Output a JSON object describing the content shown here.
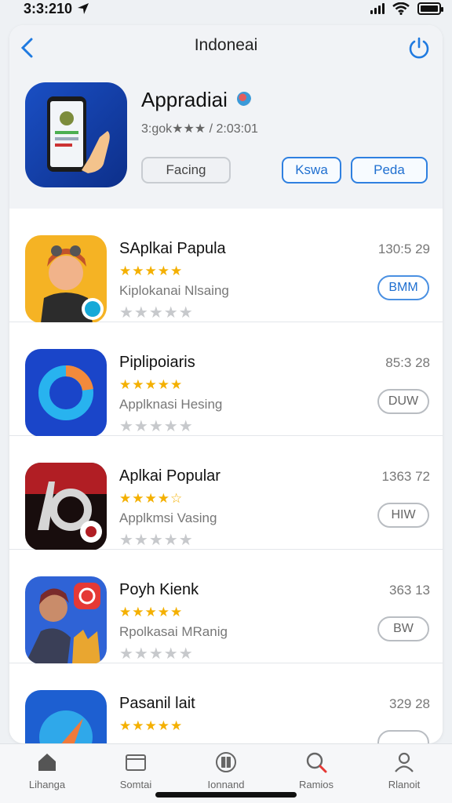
{
  "status_bar": {
    "time": "3:3:210"
  },
  "nav": {
    "title": "Indoneai"
  },
  "featured": {
    "title": "Appradiai",
    "meta": "3:gok★★★ / 2:03:01",
    "buttons": {
      "secondary": "Facing",
      "primary_1": "Kswa",
      "primary_2": "Peda"
    }
  },
  "list": [
    {
      "title": "SAplkai Papula",
      "stars": "★★★★★",
      "subtitle": "Kiplokanai Nlsaing",
      "rating_stars": "★★★★★",
      "number": "130:5 29",
      "button": "BMM",
      "button_style": "blue"
    },
    {
      "title": "Piplipoiaris",
      "stars": "★★★★★",
      "subtitle": "Applknasi Hesing",
      "rating_stars": "★★★★★",
      "number": "85:3 28",
      "button": "DUW",
      "button_style": "gray"
    },
    {
      "title": "Aplkai Popular",
      "stars": "★★★★☆",
      "subtitle": "Applkmsi Vasing",
      "rating_stars": "★★★★★",
      "number": "1363 72",
      "button": "HIW",
      "button_style": "gray"
    },
    {
      "title": "Poyh Kienk",
      "stars": "★★★★★",
      "subtitle": "Rpolkasai MRanig",
      "rating_stars": "★★★★★",
      "number": "363 13",
      "button": "BW",
      "button_style": "gray"
    },
    {
      "title": "Pasanil lait",
      "stars": "★★★★★",
      "subtitle": "",
      "rating_stars": "",
      "number": "329 28",
      "button": "",
      "button_style": "gray"
    }
  ],
  "tabbar": [
    {
      "label": "Lihanga",
      "icon": "home-icon"
    },
    {
      "label": "Somtai",
      "icon": "folder-icon"
    },
    {
      "label": "Ionnand",
      "icon": "book-icon"
    },
    {
      "label": "Ramios",
      "icon": "search-icon"
    },
    {
      "label": "Rlanoit",
      "icon": "person-icon"
    }
  ],
  "colors": {
    "accent": "#1f7ae0",
    "star": "#f4b000",
    "star_empty": "#c7c9cc"
  }
}
